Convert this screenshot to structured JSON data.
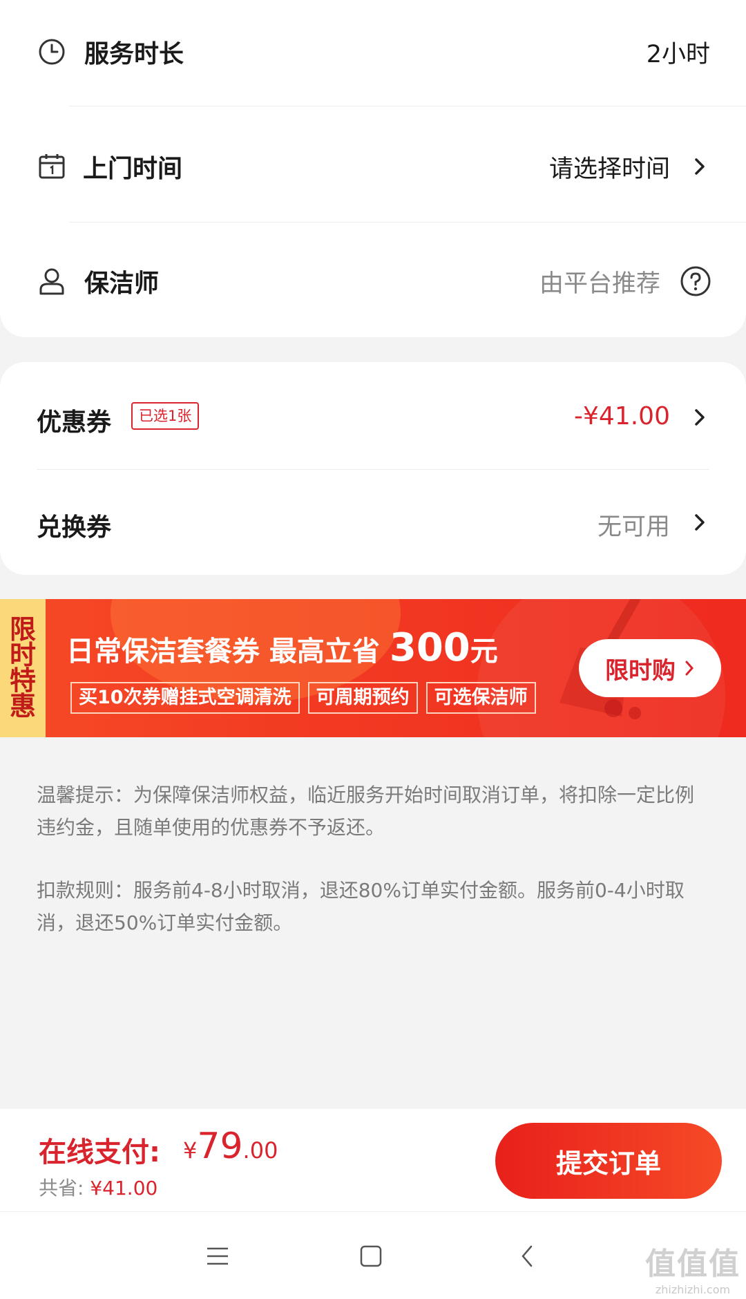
{
  "service_card": {
    "duration": {
      "label": "服务时长",
      "value": "2小时",
      "icon": "clock-icon"
    },
    "visit_time": {
      "label": "上门时间",
      "value": "请选择时间",
      "icon": "calendar-icon"
    },
    "cleaner": {
      "label": "保洁师",
      "value": "由平台推荐",
      "icon": "person-icon",
      "help_icon": "question-circle-icon"
    }
  },
  "coupon_card": {
    "coupon": {
      "label": "优惠券",
      "tag": "已选1张",
      "value": "-¥41.00"
    },
    "voucher": {
      "label": "兑换券",
      "value": "无可用"
    }
  },
  "banner": {
    "side_text": [
      "限",
      "时",
      "特",
      "惠"
    ],
    "headline": "日常保洁套餐券 最高立省 ",
    "headline_number": "300",
    "headline_unit": "元",
    "chips": [
      "买10次券赠挂式空调清洗",
      "可周期预约",
      "可选保洁师"
    ],
    "button": "限时购"
  },
  "notes": {
    "tip": "温馨提示：为保障保洁师权益，临近服务开始时间取消订单，将扣除一定比例违约金，且随单使用的优惠券不予返还。",
    "rule": "扣款规则：服务前4-8小时取消，退还80%订单实付金额。服务前0-4小时取消，退还50%订单实付金额。"
  },
  "paybar": {
    "label": "在线支付:",
    "currency": "¥",
    "amount_int": "79",
    "amount_dec": ".00",
    "saved_label": "共省: ",
    "saved_amount": "¥41.00",
    "submit": "提交订单"
  },
  "watermark": {
    "main": "值值值",
    "sub": "zhizhizhi.com"
  },
  "colors": {
    "accent": "#d9232d",
    "banner": "#f23b22",
    "banner_side": "#fbd87a"
  }
}
